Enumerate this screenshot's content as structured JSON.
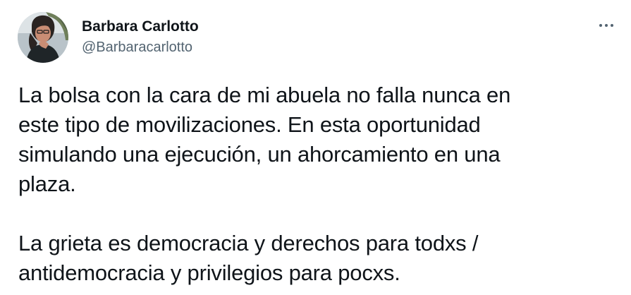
{
  "author": {
    "display_name": "Barbara Carlotto",
    "handle": "@Barbaracarlotto",
    "avatar_icon": "user-avatar-photo"
  },
  "menu": {
    "more_icon": "more-horizontal-icon"
  },
  "tweet": {
    "paragraph1": [
      "La bolsa con la cara de mi abuela no falla nunca en",
      "este tipo de movilizaciones. En esta oportunidad",
      "simulando una ejecución, un ahorcamiento en una",
      "plaza."
    ],
    "paragraph2": [
      "La grieta es democracia y derechos para todxs /",
      "antidemocracia y privilegios para pocxs."
    ]
  },
  "colors": {
    "text": "#0f1419",
    "secondary": "#536471",
    "background": "#ffffff"
  }
}
